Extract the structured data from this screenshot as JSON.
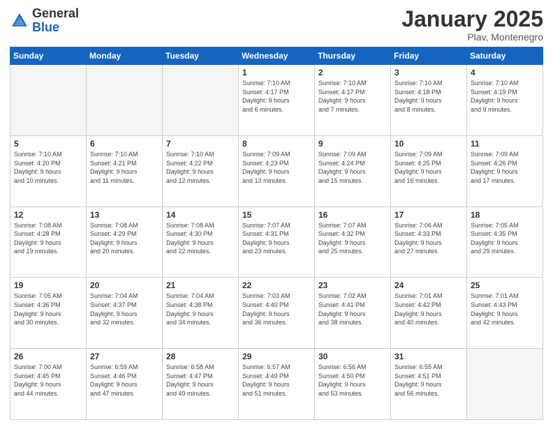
{
  "logo": {
    "general": "General",
    "blue": "Blue"
  },
  "header": {
    "month": "January 2025",
    "location": "Plav, Montenegro"
  },
  "weekdays": [
    "Sunday",
    "Monday",
    "Tuesday",
    "Wednesday",
    "Thursday",
    "Friday",
    "Saturday"
  ],
  "weeks": [
    [
      {
        "day": "",
        "info": ""
      },
      {
        "day": "",
        "info": ""
      },
      {
        "day": "",
        "info": ""
      },
      {
        "day": "1",
        "info": "Sunrise: 7:10 AM\nSunset: 4:17 PM\nDaylight: 9 hours\nand 6 minutes."
      },
      {
        "day": "2",
        "info": "Sunrise: 7:10 AM\nSunset: 4:17 PM\nDaylight: 9 hours\nand 7 minutes."
      },
      {
        "day": "3",
        "info": "Sunrise: 7:10 AM\nSunset: 4:18 PM\nDaylight: 9 hours\nand 8 minutes."
      },
      {
        "day": "4",
        "info": "Sunrise: 7:10 AM\nSunset: 4:19 PM\nDaylight: 9 hours\nand 9 minutes."
      }
    ],
    [
      {
        "day": "5",
        "info": "Sunrise: 7:10 AM\nSunset: 4:20 PM\nDaylight: 9 hours\nand 10 minutes."
      },
      {
        "day": "6",
        "info": "Sunrise: 7:10 AM\nSunset: 4:21 PM\nDaylight: 9 hours\nand 11 minutes."
      },
      {
        "day": "7",
        "info": "Sunrise: 7:10 AM\nSunset: 4:22 PM\nDaylight: 9 hours\nand 12 minutes."
      },
      {
        "day": "8",
        "info": "Sunrise: 7:09 AM\nSunset: 4:23 PM\nDaylight: 9 hours\nand 13 minutes."
      },
      {
        "day": "9",
        "info": "Sunrise: 7:09 AM\nSunset: 4:24 PM\nDaylight: 9 hours\nand 15 minutes."
      },
      {
        "day": "10",
        "info": "Sunrise: 7:09 AM\nSunset: 4:25 PM\nDaylight: 9 hours\nand 16 minutes."
      },
      {
        "day": "11",
        "info": "Sunrise: 7:09 AM\nSunset: 4:26 PM\nDaylight: 9 hours\nand 17 minutes."
      }
    ],
    [
      {
        "day": "12",
        "info": "Sunrise: 7:08 AM\nSunset: 4:28 PM\nDaylight: 9 hours\nand 19 minutes."
      },
      {
        "day": "13",
        "info": "Sunrise: 7:08 AM\nSunset: 4:29 PM\nDaylight: 9 hours\nand 20 minutes."
      },
      {
        "day": "14",
        "info": "Sunrise: 7:08 AM\nSunset: 4:30 PM\nDaylight: 9 hours\nand 22 minutes."
      },
      {
        "day": "15",
        "info": "Sunrise: 7:07 AM\nSunset: 4:31 PM\nDaylight: 9 hours\nand 23 minutes."
      },
      {
        "day": "16",
        "info": "Sunrise: 7:07 AM\nSunset: 4:32 PM\nDaylight: 9 hours\nand 25 minutes."
      },
      {
        "day": "17",
        "info": "Sunrise: 7:06 AM\nSunset: 4:33 PM\nDaylight: 9 hours\nand 27 minutes."
      },
      {
        "day": "18",
        "info": "Sunrise: 7:05 AM\nSunset: 4:35 PM\nDaylight: 9 hours\nand 29 minutes."
      }
    ],
    [
      {
        "day": "19",
        "info": "Sunrise: 7:05 AM\nSunset: 4:36 PM\nDaylight: 9 hours\nand 30 minutes."
      },
      {
        "day": "20",
        "info": "Sunrise: 7:04 AM\nSunset: 4:37 PM\nDaylight: 9 hours\nand 32 minutes."
      },
      {
        "day": "21",
        "info": "Sunrise: 7:04 AM\nSunset: 4:38 PM\nDaylight: 9 hours\nand 34 minutes."
      },
      {
        "day": "22",
        "info": "Sunrise: 7:03 AM\nSunset: 4:40 PM\nDaylight: 9 hours\nand 36 minutes."
      },
      {
        "day": "23",
        "info": "Sunrise: 7:02 AM\nSunset: 4:41 PM\nDaylight: 9 hours\nand 38 minutes."
      },
      {
        "day": "24",
        "info": "Sunrise: 7:01 AM\nSunset: 4:42 PM\nDaylight: 9 hours\nand 40 minutes."
      },
      {
        "day": "25",
        "info": "Sunrise: 7:01 AM\nSunset: 4:43 PM\nDaylight: 9 hours\nand 42 minutes."
      }
    ],
    [
      {
        "day": "26",
        "info": "Sunrise: 7:00 AM\nSunset: 4:45 PM\nDaylight: 9 hours\nand 44 minutes."
      },
      {
        "day": "27",
        "info": "Sunrise: 6:59 AM\nSunset: 4:46 PM\nDaylight: 9 hours\nand 47 minutes."
      },
      {
        "day": "28",
        "info": "Sunrise: 6:58 AM\nSunset: 4:47 PM\nDaylight: 9 hours\nand 49 minutes."
      },
      {
        "day": "29",
        "info": "Sunrise: 6:57 AM\nSunset: 4:49 PM\nDaylight: 9 hours\nand 51 minutes."
      },
      {
        "day": "30",
        "info": "Sunrise: 6:56 AM\nSunset: 4:50 PM\nDaylight: 9 hours\nand 53 minutes."
      },
      {
        "day": "31",
        "info": "Sunrise: 6:55 AM\nSunset: 4:51 PM\nDaylight: 9 hours\nand 56 minutes."
      },
      {
        "day": "",
        "info": ""
      }
    ]
  ]
}
